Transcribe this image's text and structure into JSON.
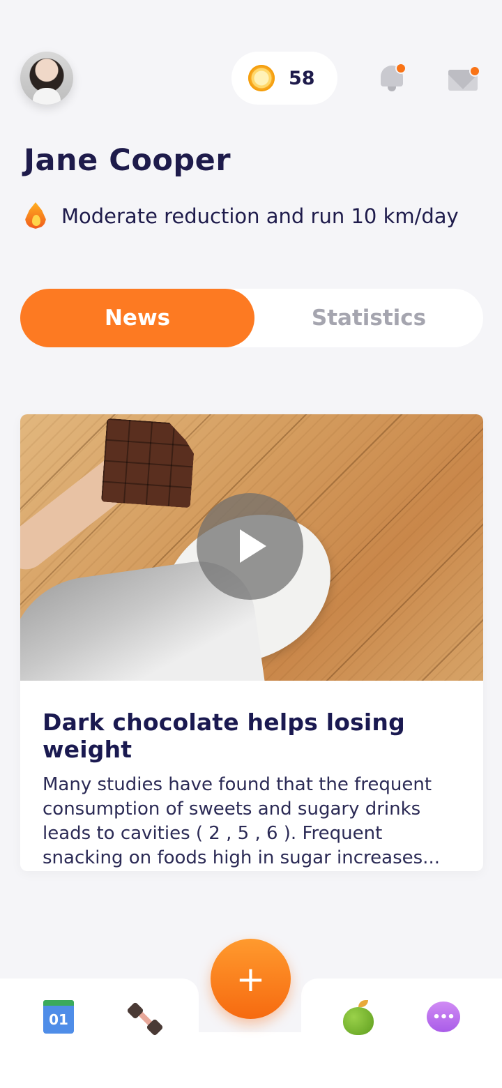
{
  "header": {
    "coins": "58",
    "user_name": "Jane Cooper",
    "goal": "Moderate reduction and run 10 km/day"
  },
  "tabs": [
    {
      "label": "News",
      "active": true
    },
    {
      "label": "Statistics",
      "active": false
    }
  ],
  "article": {
    "title": "Dark chocolate helps losing weight",
    "description": "Many studies have found that the frequent consumption of sweets and sugary drinks leads to cavities ( 2 , 5 , 6 ). Frequent snacking on foods high in sugar increases..."
  },
  "bottom_nav": {
    "calendar_day": "01",
    "fab_label": "+",
    "chat_glyph": "•••"
  },
  "colors": {
    "accent": "#FD7A22",
    "background": "#F5F5F8",
    "text_dark": "#1E1B4B",
    "tab_inactive": "#A5A5AF"
  },
  "icons": [
    "avatar",
    "coin-icon",
    "bell-icon",
    "mail-icon",
    "flame-icon",
    "play-icon",
    "calendar-icon",
    "dumbbell-icon",
    "apple-icon",
    "chat-icon",
    "plus-icon"
  ]
}
